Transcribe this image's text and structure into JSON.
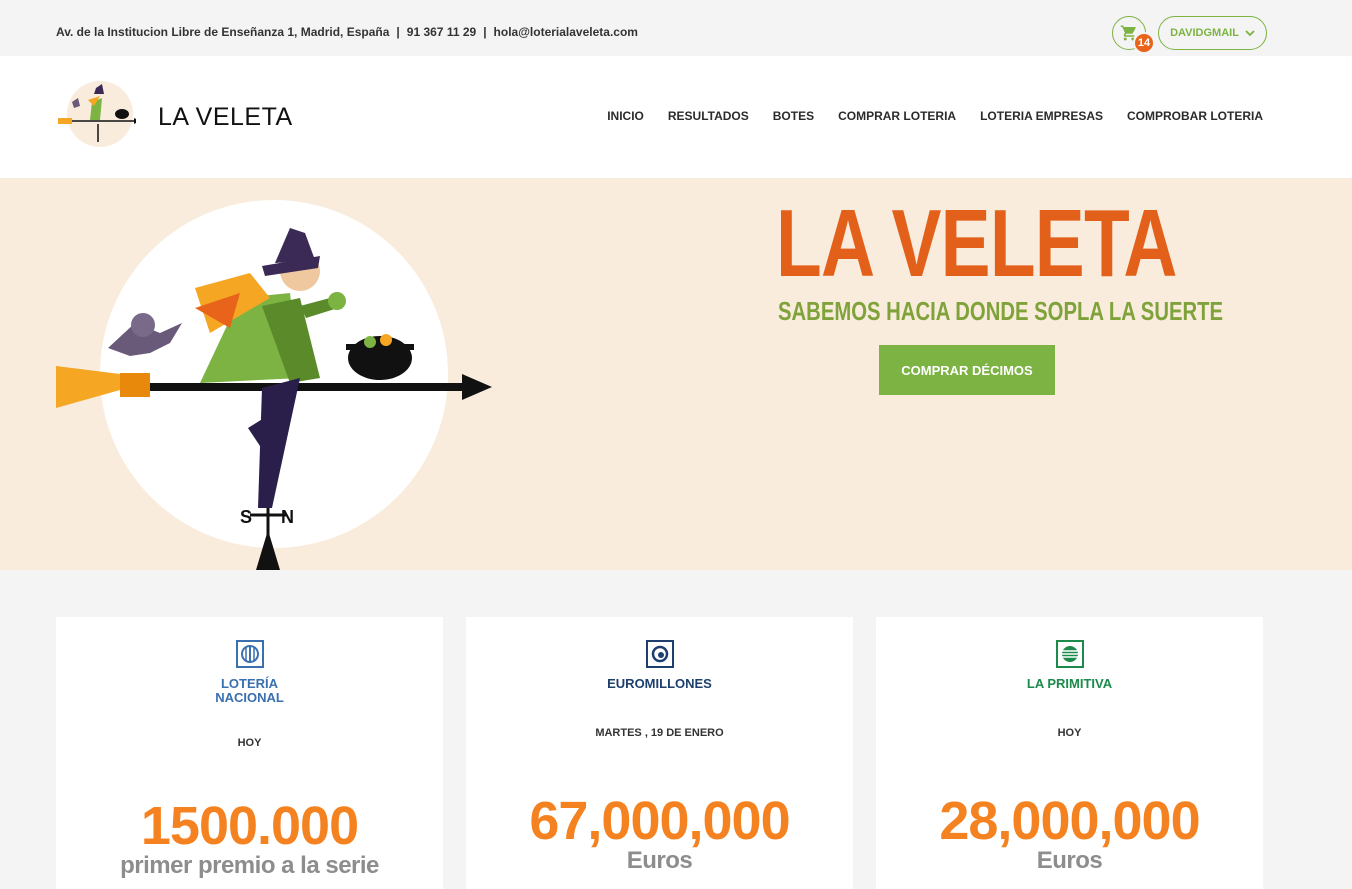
{
  "topbar": {
    "address": "Av. de la Institucion Libre de Enseñanza 1, Madrid, España",
    "phone": "91 367 11 29",
    "email": "hola@loterialaveleta.com",
    "separator": "|",
    "cart_count": "14",
    "user_label": "DAVIDGMAIL",
    "cart_icon": "cart-icon",
    "user_chevron_icon": "chevron-down-icon"
  },
  "header": {
    "brand": "LA VELETA",
    "nav": [
      "INICIO",
      "RESULTADOS",
      "BOTES",
      "COMPRAR LOTERIA",
      "LOTERIA EMPRESAS",
      "COMPROBAR LOTERIA"
    ]
  },
  "hero": {
    "title": "LA VELETA",
    "subtitle": "SABEMOS HACIA DONDE SOPLA LA SUERTE",
    "cta": "COMPRAR DÉCIMOS",
    "compass_s": "S",
    "compass_n": "N"
  },
  "cards": [
    {
      "name_line1": "LOTERÍA",
      "name_line2": "NACIONAL",
      "date": "HOY",
      "amount": "1500.000",
      "unit": "primer premio a la serie",
      "color": "#3a6fb0"
    },
    {
      "name_line1": "EUROMILLONES",
      "name_line2": "",
      "date": "MARTES , 19 DE ENERO",
      "amount": "67,000,000",
      "unit": "Euros",
      "color": "#1d3f6e"
    },
    {
      "name_line1": "LA PRIMITIVA",
      "name_line2": "",
      "date": "HOY",
      "amount": "28,000,000",
      "unit": "Euros",
      "color": "#1c8a4a"
    }
  ],
  "colors": {
    "brand_orange": "#e3601b",
    "brand_green": "#7cb342",
    "amount_orange": "#f58220",
    "hero_bg": "#f9ecdc"
  }
}
